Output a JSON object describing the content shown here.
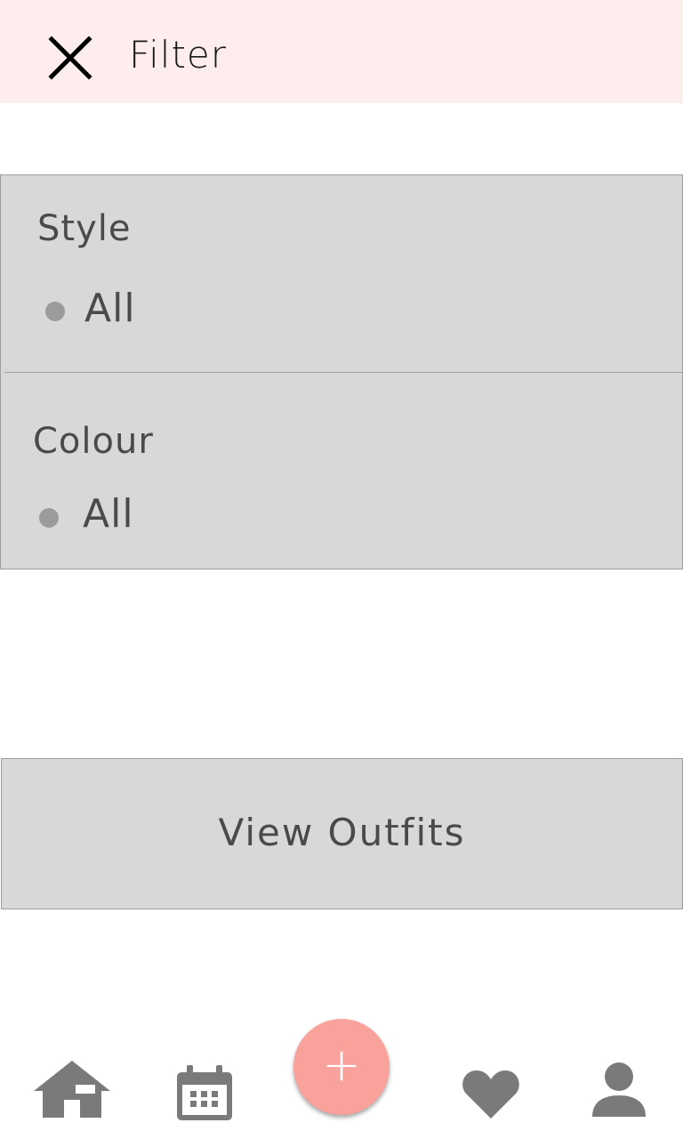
{
  "header": {
    "title": "Filter",
    "close_icon": "close-icon",
    "background": "#feeded"
  },
  "filters": {
    "style": {
      "title": "Style",
      "selected_option": "All"
    },
    "colour": {
      "title": "Colour",
      "selected_option": "All"
    }
  },
  "actions": {
    "view_outfits_label": "View Outfits"
  },
  "bottom_nav": {
    "items": [
      {
        "icon": "home-icon"
      },
      {
        "icon": "calendar-icon"
      },
      {
        "icon": "add-icon",
        "glyph": "+"
      },
      {
        "icon": "heart-icon"
      },
      {
        "icon": "user-icon"
      }
    ],
    "icon_color": "#7a7a7a",
    "fab_color": "#f9a19b"
  }
}
